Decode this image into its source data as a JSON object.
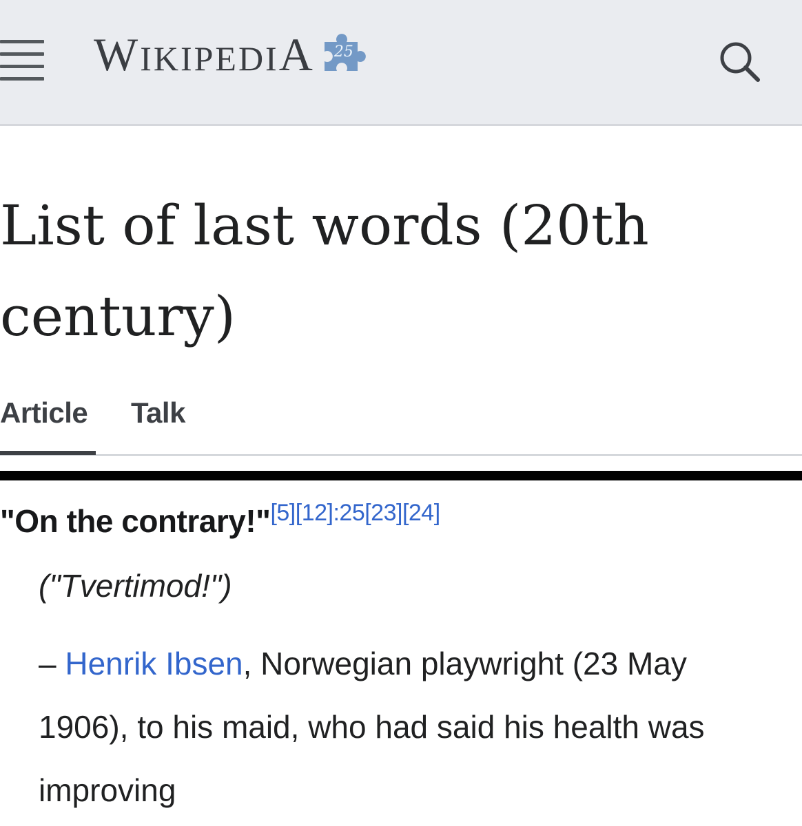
{
  "header": {
    "logo_first": "W",
    "logo_middle": "IKIPEDI",
    "logo_last": "A",
    "anniversary_badge": "25",
    "menu_icon": "hamburger-menu-icon",
    "search_icon": "magnifier-search-icon",
    "background": "#eaecf0",
    "puzzle_color": "#7399c6"
  },
  "page": {
    "title": "List of last words (20th century)"
  },
  "tabs": {
    "items": [
      {
        "label": "Article",
        "active": true
      },
      {
        "label": "Talk",
        "active": false
      }
    ]
  },
  "entry": {
    "quote": "\"On the contrary!\"",
    "refs": "[5][12]:25[23][24]",
    "translation": "(\"Tvertimod!\")",
    "dash": "– ",
    "person_link": "Henrik Ibsen",
    "description": ", Norwegian playwright (23 May 1906), to his maid, who had said his health was improving"
  },
  "colors": {
    "link": "#3366cc",
    "text": "#202122"
  }
}
